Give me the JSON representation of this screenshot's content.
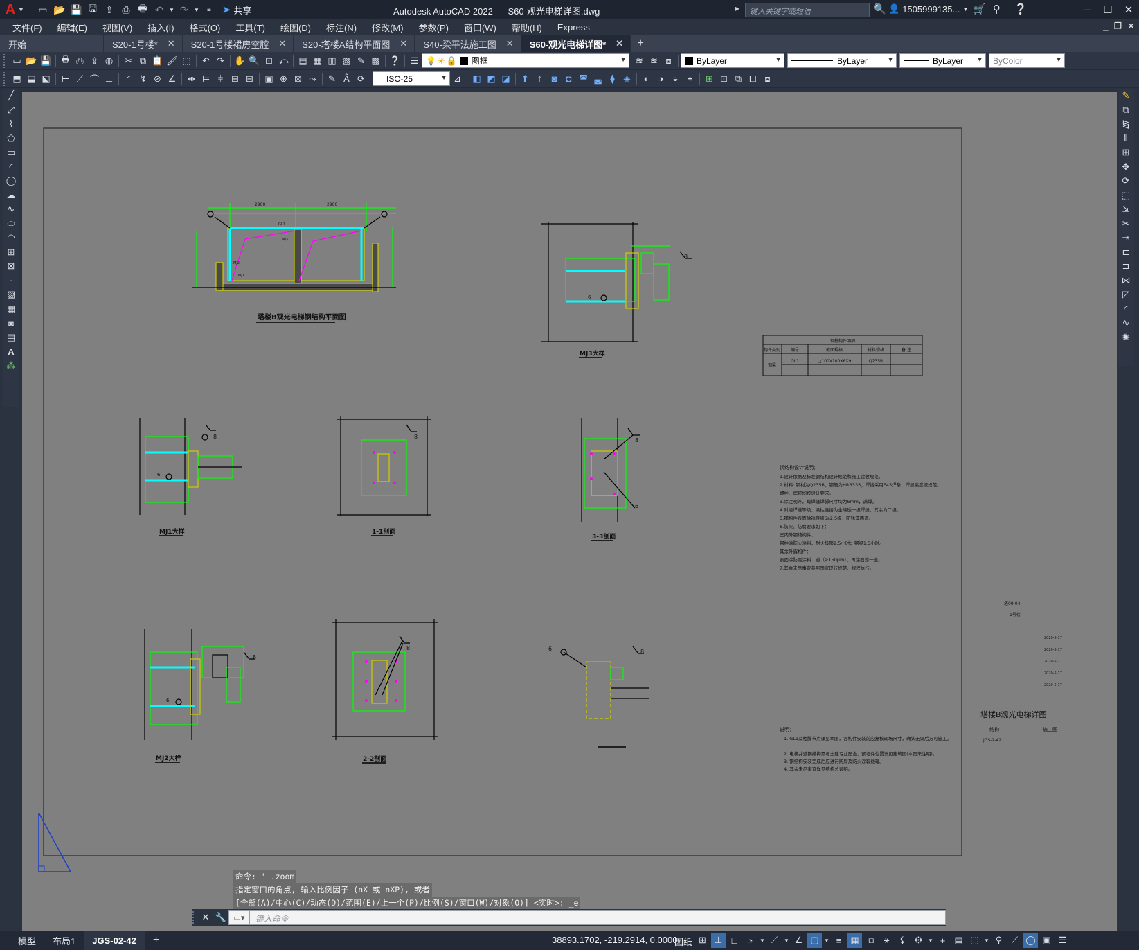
{
  "app": {
    "title": "Autodesk AutoCAD 2022",
    "document": "S60-观光电梯详图.dwg",
    "logo": "A",
    "share_label": "共享",
    "search_placeholder": "键入关键字或短语",
    "user": "1505999135...",
    "accent": "#e2231a"
  },
  "menu": [
    "文件(F)",
    "编辑(E)",
    "视图(V)",
    "插入(I)",
    "格式(O)",
    "工具(T)",
    "绘图(D)",
    "标注(N)",
    "修改(M)",
    "参数(P)",
    "窗口(W)",
    "帮助(H)",
    "Express"
  ],
  "tabs": [
    {
      "label": "开始",
      "closable": false,
      "active": false
    },
    {
      "label": "S20-1号楼*",
      "closable": true,
      "active": false
    },
    {
      "label": "S20-1号楼裙房空腔",
      "closable": true,
      "active": false
    },
    {
      "label": "S20-塔楼A结构平面图",
      "closable": true,
      "active": false
    },
    {
      "label": "S40-梁平法施工图",
      "closable": true,
      "active": false
    },
    {
      "label": "S60-观光电梯详图*",
      "closable": true,
      "active": true
    }
  ],
  "toolbar": {
    "layer_name": "图框",
    "color": "ByLayer",
    "linetype": "ByLayer",
    "lineweight": "ByLayer",
    "plotstyle": "ByColor",
    "dimstyle": "ByLayer"
  },
  "toolbar2": {
    "textstyle": "ISO-25"
  },
  "drawing": {
    "plan_title": "塔楼B观光电梯钢结构平面图",
    "mj3_title": "MJ3大样",
    "mj1_title": "MJ1大样",
    "sec11_title": "1-1剖面",
    "sec33_title": "3-3剖面",
    "mj2_title": "MJ2大样",
    "sec22_title": "2-2剖面",
    "table_header": "钢柱构件明细",
    "table_cols": [
      "构件类别",
      "编号",
      "截面规格",
      "材料规格",
      "备 注"
    ],
    "table_row": [
      "钢梁",
      "GL1",
      "□100X100X6X9",
      "Q235B",
      ""
    ],
    "notes_title": "钢结构设计说明：",
    "notes_lines": [
      "1.设计依据及标准钢结构设计规范和施工验收规范。",
      "2.材料: 钢材为Q235B；钢筋为HRB335；焊接采用E43焊条，焊缝高度按规范。",
      "   螺栓、焊钉均按设计要求。",
      "3.除注明外，角焊缝焊脚尺寸均为6mm，满焊。",
      "4.对接焊缝等级：梁柱连接为全熔透一级焊缝，其余为二级。",
      "5.钢构件表面除锈等级Sa2.5级，防锈漆两道。",
      "6.防火、防腐要求如下：",
      "   室内外钢结构件：",
      "     钢柱涂防火涂料，耐火极限2.5小时；钢梁1.5小时。",
      "   其余外露构件：",
      "     表面涂防腐涂料二道（≥150μm），再涂面漆一道。",
      "7.其余未尽事宜参照国家现行规范、规程执行。"
    ],
    "explain_title": "说明：",
    "explain_lines": [
      "1. GL1及柱脚节点详见本图，各构件安装前应复核现场尺寸，确认无误后方可施工。",
      "2. 电梯井道钢结构需与土建专业配合，预埋件位置详见建筑图(本图未注明)。",
      "3. 钢结构安装完成后应进行防腐及防火涂装处理。",
      "4. 其余未尽事宜详见结构总说明。"
    ],
    "titleblock_name": "塔楼B观光电梯详图",
    "titleblock_project": "1号楼",
    "titleblock_code": "塔09-04",
    "titleblock_disc": "结构",
    "titleblock_stage": "施工图",
    "titleblock_no": "JGS-2-42",
    "titleblock_dates": [
      "2020-5-17",
      "2020-5-17",
      "2020-5-17",
      "2020-5-17",
      "2020-5-17"
    ]
  },
  "command": {
    "history": [
      "命令: '_.zoom",
      "指定窗口的角点, 输入比例因子 (nX 或 nXP), 或者",
      "[全部(A)/中心(C)/动态(D)/范围(E)/上一个(P)/比例(S)/窗口(W)/对象(O)] <实时>: _e"
    ],
    "placeholder": "键入命令"
  },
  "status": {
    "layout_tabs": [
      "模型",
      "布局1",
      "JGS-02-42"
    ],
    "active_layout": "JGS-02-42",
    "coords": "38893.1702, -219.2914, 0.0000",
    "space": "图纸"
  }
}
